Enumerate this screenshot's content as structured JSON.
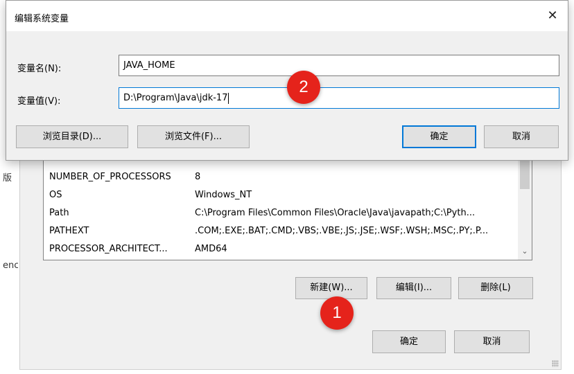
{
  "background_window": {
    "left_edge_text_1": "版",
    "left_edge_text_2": "enc",
    "variables": [
      {
        "name": "",
        "value": ""
      },
      {
        "name": "NUMBER_OF_PROCESSORS",
        "value": "8"
      },
      {
        "name": "OS",
        "value": "Windows_NT"
      },
      {
        "name": "Path",
        "value": "C:\\Program Files\\Common Files\\Oracle\\Java\\javapath;C:\\Pyth..."
      },
      {
        "name": "PATHEXT",
        "value": ".COM;.EXE;.BAT;.CMD;.VBS;.VBE;.JS;.JSE;.WSF;.WSH;.MSC;.PY;.P..."
      },
      {
        "name": "PROCESSOR_ARCHITECT...",
        "value": "AMD64"
      }
    ],
    "buttons": {
      "new": "新建(W)...",
      "edit": "编辑(I)...",
      "delete": "删除(L)",
      "ok": "确定",
      "cancel": "取消"
    }
  },
  "dialog": {
    "title": "编辑系统变量",
    "close_glyph": "✕",
    "name_label": "变量名(N):",
    "name_value": "JAVA_HOME",
    "value_label": "变量值(V):",
    "value_value": "D:\\Program\\Java\\jdk-17",
    "buttons": {
      "browse_dir": "浏览目录(D)...",
      "browse_file": "浏览文件(F)...",
      "ok": "确定",
      "cancel": "取消"
    }
  },
  "markers": {
    "step1": "1",
    "step2": "2"
  },
  "colors": {
    "accent": "#0078d7",
    "marker": "#e5231b"
  }
}
